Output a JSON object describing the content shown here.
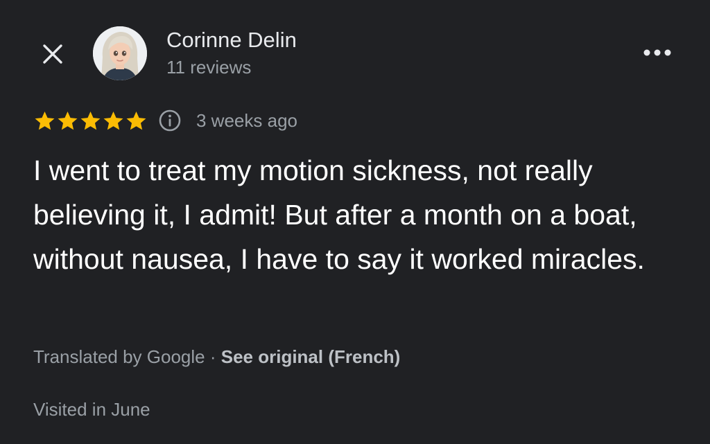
{
  "header": {
    "close_icon": "close-icon",
    "author_name": "Corinne Delin",
    "author_reviews": "11 reviews",
    "avatar_icon": "user-avatar",
    "more_icon": "more-horizontal-icon"
  },
  "review": {
    "rating": 5,
    "rating_max": 5,
    "star_color": "#fbbc04",
    "info_icon": "info-icon",
    "date": "3 weeks ago",
    "text": "I went to treat my motion sickness, not really believing it, I admit! But after a month on a boat, without nausea, I have to say it worked miracles."
  },
  "translation": {
    "label": "Translated by Google",
    "separator": " · ",
    "link_label": "See original (French)"
  },
  "visited": "Visited in June",
  "colors": {
    "background": "#202124",
    "primary_text": "#e8eaed",
    "secondary_text": "#9aa0a6",
    "star": "#fbbc04"
  }
}
